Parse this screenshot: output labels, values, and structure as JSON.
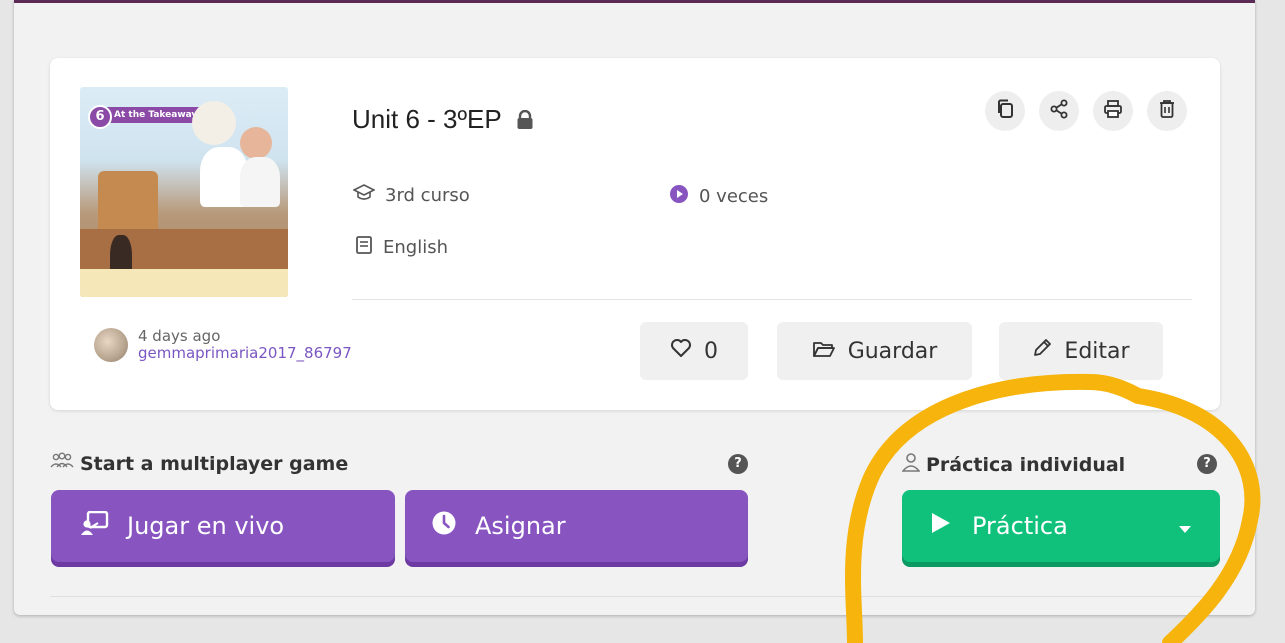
{
  "quiz": {
    "title": "Unit 6 - 3ºEP",
    "grade": "3rd curso",
    "plays": "0 veces",
    "subject": "English",
    "thumbnail": {
      "unit_number": "6",
      "banner_text": "At the Takeaway"
    }
  },
  "author": {
    "time_ago": "4 days ago",
    "username": "gemmaprimaria2017_86797"
  },
  "actions": {
    "likes_count": "0",
    "save_label": "Guardar",
    "edit_label": "Editar"
  },
  "toolbar_icons": [
    "copy-icon",
    "share-icon",
    "print-icon",
    "trash-icon"
  ],
  "multiplayer": {
    "label": "Start a multiplayer game",
    "live_label": "Jugar en vivo",
    "assign_label": "Asignar"
  },
  "individual": {
    "label": "Práctica individual",
    "practice_label": "Práctica"
  },
  "colors": {
    "purple": "#8854c0",
    "green": "#10c17c",
    "highlight": "#f6b40c",
    "link": "#7a56c2"
  }
}
